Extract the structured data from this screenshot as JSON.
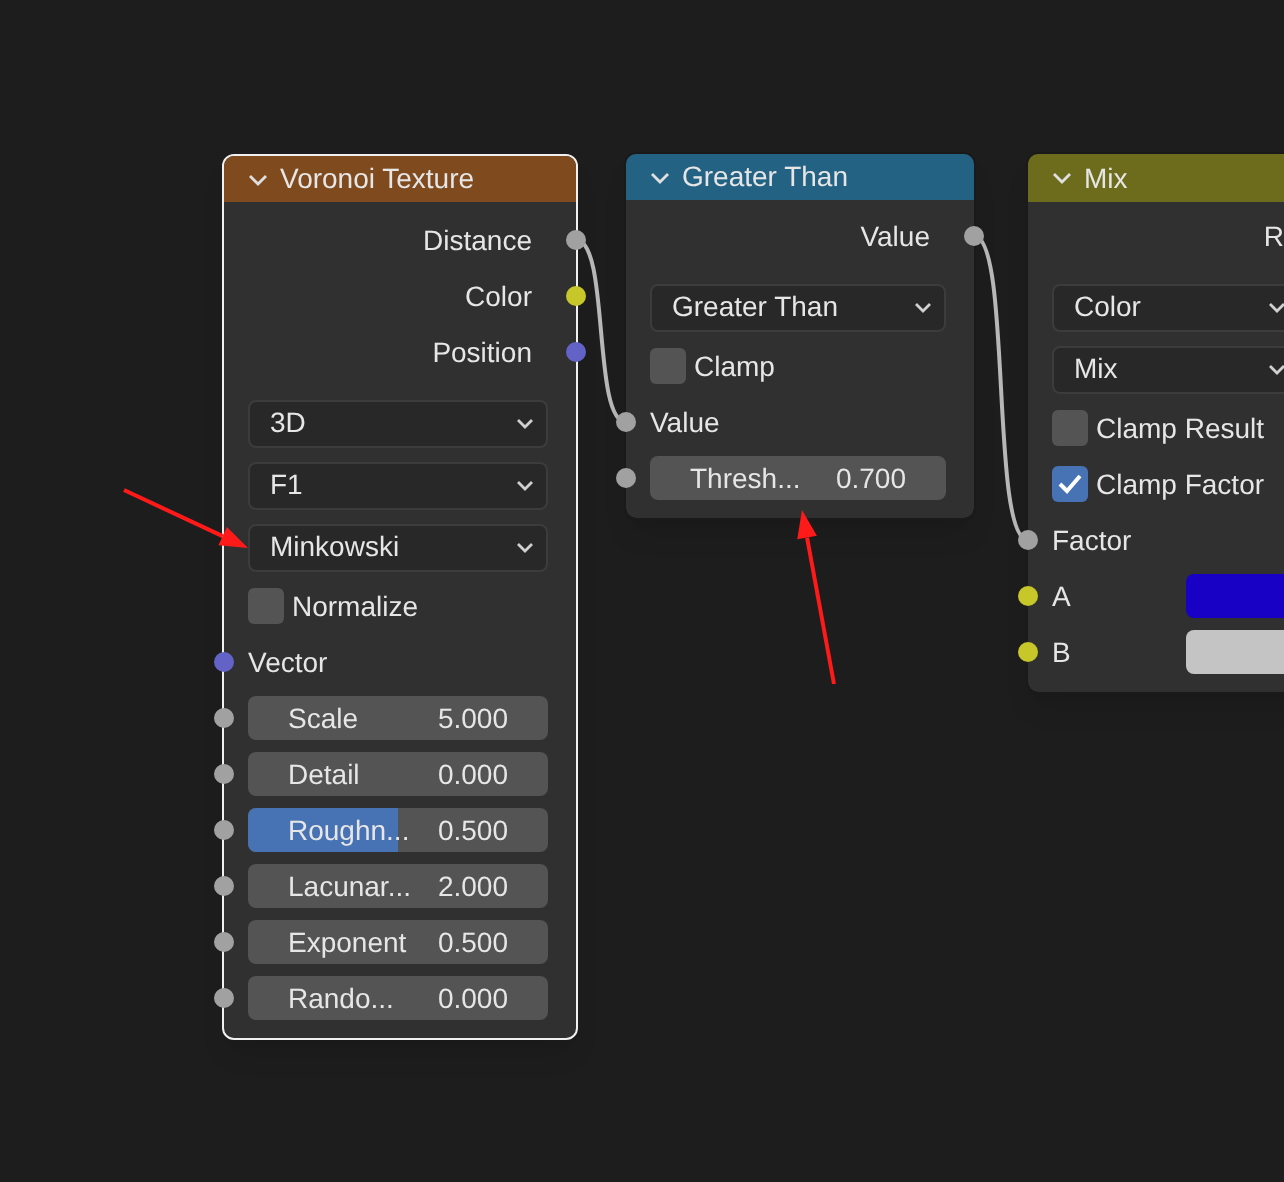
{
  "nodes": [
    {
      "title": "Voronoi Texture",
      "color": "#7f4b1e",
      "selected": true,
      "rows": [
        {
          "kind": "output",
          "label": "Distance",
          "color": "#a1a1a1"
        },
        {
          "kind": "output",
          "label": "Color",
          "color": "#c7c729"
        },
        {
          "kind": "output",
          "label": "Position",
          "color": "#6363c7"
        },
        {
          "kind": "dropdown",
          "value": "3D"
        },
        {
          "kind": "dropdown",
          "value": "F1"
        },
        {
          "kind": "dropdown",
          "value": "Minkowski"
        },
        {
          "kind": "checkbox",
          "label": "Normalize",
          "checked": false
        },
        {
          "kind": "input",
          "label": "Vector",
          "color": "#6363c7"
        },
        {
          "kind": "number",
          "label": "Scale",
          "value": "5.000",
          "color": "#a1a1a1"
        },
        {
          "kind": "number",
          "label": "Detail",
          "value": "0.000",
          "color": "#a1a1a1"
        },
        {
          "kind": "slider",
          "label": "Roughn...",
          "value": "0.500",
          "level": 0.5,
          "color": "#a1a1a1"
        },
        {
          "kind": "number",
          "label": "Lacunar...",
          "value": "2.000",
          "color": "#a1a1a1"
        },
        {
          "kind": "number",
          "label": "Exponent",
          "value": "0.500",
          "color": "#a1a1a1"
        },
        {
          "kind": "number",
          "label": "Rando...",
          "value": "0.000",
          "color": "#a1a1a1"
        }
      ]
    },
    {
      "title": "Greater Than",
      "color": "#246283",
      "selected": false,
      "rows": [
        {
          "kind": "output",
          "label": "Value",
          "color": "#a1a1a1"
        },
        {
          "kind": "dropdown",
          "value": "Greater Than"
        },
        {
          "kind": "checkbox",
          "label": "Clamp",
          "checked": false
        },
        {
          "kind": "input",
          "label": "Value",
          "color": "#a1a1a1"
        },
        {
          "kind": "number",
          "label": "Thresh...",
          "value": "0.700",
          "color": "#a1a1a1"
        }
      ]
    },
    {
      "title": "Mix",
      "color": "#6c6c1c",
      "selected": false,
      "rows": [
        {
          "kind": "output",
          "label": "R"
        },
        {
          "kind": "dropdown",
          "value": "Color"
        },
        {
          "kind": "dropdown",
          "value": "Mix"
        },
        {
          "kind": "checkbox",
          "label": "Clamp Result",
          "checked": false
        },
        {
          "kind": "checkbox",
          "label": "Clamp Factor",
          "checked": true
        },
        {
          "kind": "input",
          "label": "Factor",
          "color": "#a1a1a1"
        },
        {
          "kind": "color_input",
          "label": "A",
          "color": "#1800c4"
        },
        {
          "kind": "color_input",
          "label": "B",
          "color": "#c4c4c4"
        }
      ]
    }
  ]
}
